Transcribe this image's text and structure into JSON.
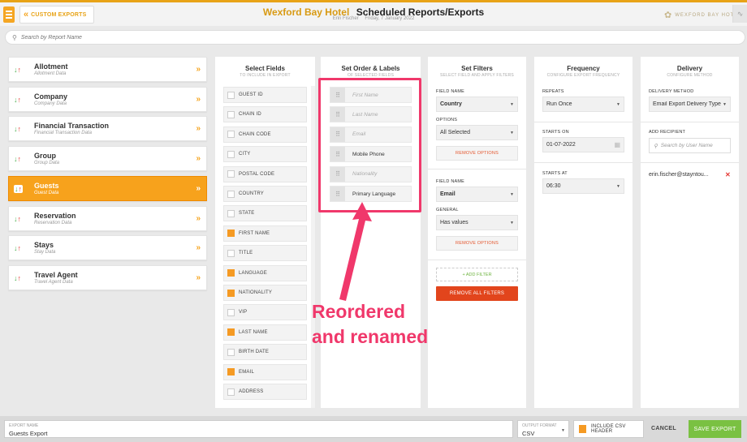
{
  "header": {
    "custom_exports_label": "CUSTOM EXPORTS",
    "hotel_name": "Wexford Bay Hotel",
    "page_title": "Scheduled Reports/Exports",
    "user": "Erin Fischer",
    "date": "Friday, 7 January 2022",
    "logo_text": "WEXFORD BAY HOTEL"
  },
  "search": {
    "placeholder": "Search by Report Name"
  },
  "categories": [
    {
      "name": "Allotment",
      "sub": "Allotment Data",
      "active": false
    },
    {
      "name": "Company",
      "sub": "Company Data",
      "active": false
    },
    {
      "name": "Financial Transaction",
      "sub": "Financial Transaction Data",
      "active": false
    },
    {
      "name": "Group",
      "sub": "Group Data",
      "active": false
    },
    {
      "name": "Guests",
      "sub": "Guest Data",
      "active": true
    },
    {
      "name": "Reservation",
      "sub": "Reservation Data",
      "active": false
    },
    {
      "name": "Stays",
      "sub": "Stay Data",
      "active": false
    },
    {
      "name": "Travel Agent",
      "sub": "Travel Agent Data",
      "active": false
    }
  ],
  "select_fields": {
    "title": "Select Fields",
    "subtitle": "TO INCLUDE IN EXPORT",
    "fields": [
      {
        "label": "GUEST ID",
        "checked": false
      },
      {
        "label": "CHAIN ID",
        "checked": false
      },
      {
        "label": "CHAIN CODE",
        "checked": false
      },
      {
        "label": "CITY",
        "checked": false
      },
      {
        "label": "POSTAL CODE",
        "checked": false
      },
      {
        "label": "COUNTRY",
        "checked": false
      },
      {
        "label": "STATE",
        "checked": false
      },
      {
        "label": "FIRST NAME",
        "checked": true
      },
      {
        "label": "TITLE",
        "checked": false
      },
      {
        "label": "LANGUAGE",
        "checked": true
      },
      {
        "label": "NATIONALITY",
        "checked": true
      },
      {
        "label": "VIP",
        "checked": false
      },
      {
        "label": "LAST NAME",
        "checked": true
      },
      {
        "label": "BIRTH DATE",
        "checked": false
      },
      {
        "label": "EMAIL",
        "checked": true
      },
      {
        "label": "ADDRESS",
        "checked": false
      }
    ]
  },
  "order": {
    "title": "Set Order & Labels",
    "subtitle": "OF SELECTED FIELDS",
    "items": [
      {
        "text": "First Name",
        "placeholder": true
      },
      {
        "text": "Last Name",
        "placeholder": true
      },
      {
        "text": "Email",
        "placeholder": true
      },
      {
        "text": "Mobile Phone",
        "placeholder": false
      },
      {
        "text": "Nationality",
        "placeholder": true
      },
      {
        "text": "Primary Language",
        "placeholder": false
      }
    ]
  },
  "filters": {
    "title": "Set Filters",
    "subtitle": "SELECT FIELD AND APPLY FILTERS",
    "field_name_label": "FIELD NAME",
    "field1": "Country",
    "options_label": "OPTIONS",
    "options_value": "All Selected",
    "remove_options": "REMOVE OPTIONS",
    "field2": "Email",
    "general_label": "GENERAL",
    "general_value": "Has values",
    "add_filter": "+ ADD FILTER",
    "remove_all": "REMOVE ALL FILTERS"
  },
  "frequency": {
    "title": "Frequency",
    "subtitle": "CONFIGURE EXPORT FREQUENCY",
    "repeats_label": "REPEATS",
    "repeats_value": "Run Once",
    "starts_on_label": "STARTS ON",
    "starts_on_value": "01-07-2022",
    "starts_at_label": "STARTS AT",
    "starts_at_value": "06:30"
  },
  "delivery": {
    "title": "Delivery",
    "subtitle": "CONFIGURE METHOD",
    "method_label": "DELIVERY METHOD",
    "method_value": "Email Export Delivery Type",
    "add_recipient_label": "ADD RECIPIENT",
    "recipient_placeholder": "Search by User Name",
    "recipient": "erin.fischer@stayntou..."
  },
  "annotation": {
    "line1": "Reordered",
    "line2": "and renamed",
    "color": "#f0386b"
  },
  "footer": {
    "export_name_label": "EXPORT NAME",
    "export_name_value": "Guests Export",
    "output_format_label": "OUTPUT FORMAT",
    "output_format_value": "CSV",
    "include_csv_header": "INCLUDE CSV HEADER",
    "cancel": "CANCEL",
    "save": "SAVE EXPORT"
  },
  "colors": {
    "accent": "#f7a21c",
    "danger": "#e2451c",
    "success": "#7ac142"
  }
}
